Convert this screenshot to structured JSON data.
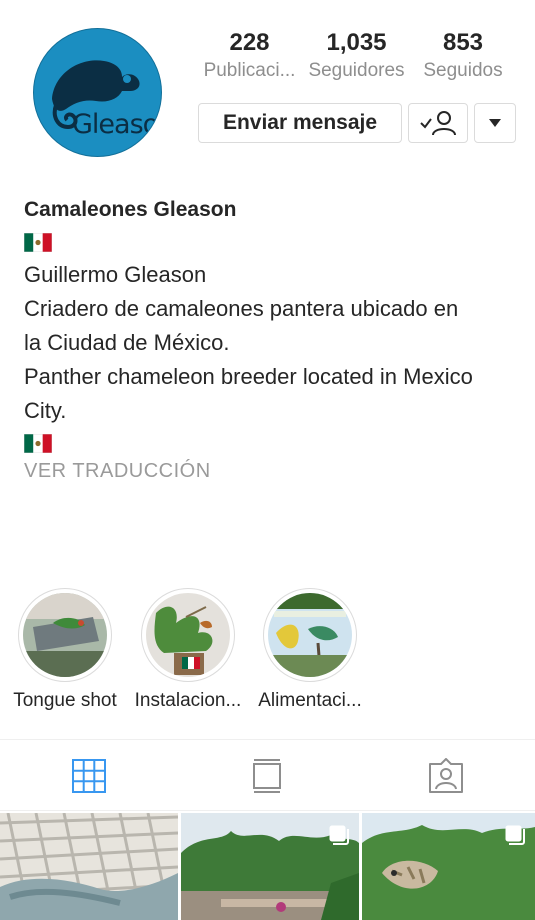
{
  "profile": {
    "avatar_text": "Gleason",
    "display_name": "Camaleones Gleason",
    "bio_lines": [
      "Guillermo Gleason",
      "Criadero de camaleones pantera ubicado en",
      "la Ciudad de México.",
      "Panther chameleon breeder located in Mexico",
      "City."
    ],
    "translate_label": "VER TRADUCCIÓN"
  },
  "stats": [
    {
      "value": "228",
      "label": "Publicaci..."
    },
    {
      "value": "1,035",
      "label": "Seguidores"
    },
    {
      "value": "853",
      "label": "Seguidos"
    }
  ],
  "actions": {
    "message_label": "Enviar mensaje",
    "following_icon": "person-check-icon",
    "more_icon": "caret-down-icon"
  },
  "highlights": [
    {
      "label": "Tongue shot"
    },
    {
      "label": "Instalacion..."
    },
    {
      "label": "Alimentaci..."
    }
  ],
  "tabs": [
    {
      "icon": "grid-icon",
      "active": true
    },
    {
      "icon": "feed-icon",
      "active": false
    },
    {
      "icon": "tagged-icon",
      "active": false
    }
  ],
  "colors": {
    "accent_blue": "#3897f0",
    "avatar_bg": "#1b8ec1",
    "text": "#262626",
    "muted": "#8e8e8e"
  }
}
